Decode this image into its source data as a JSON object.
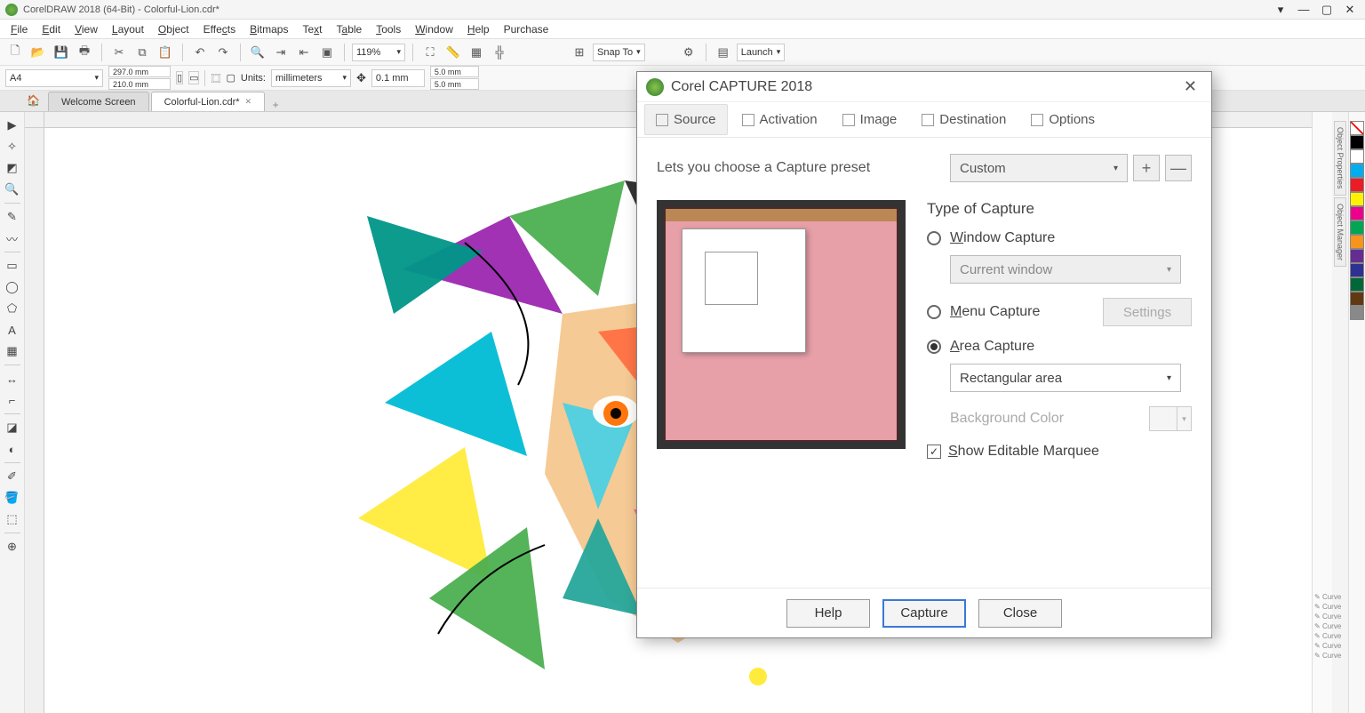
{
  "titlebar": {
    "text": "CorelDRAW 2018 (64-Bit) - Colorful-Lion.cdr*"
  },
  "menus": [
    "File",
    "Edit",
    "View",
    "Layout",
    "Object",
    "Effects",
    "Bitmaps",
    "Text",
    "Table",
    "Tools",
    "Window",
    "Help",
    "Purchase"
  ],
  "toolbar": {
    "zoom": "119%",
    "snap_label": "Snap To",
    "launch_label": "Launch"
  },
  "propbar": {
    "paper": "A4",
    "width": "297.0 mm",
    "height": "210.0 mm",
    "units_label": "Units:",
    "units": "millimeters",
    "nudge": "0.1 mm",
    "dup_x": "5.0 mm",
    "dup_y": "5.0 mm"
  },
  "tabs": {
    "welcome": "Welcome Screen",
    "doc": "Colorful-Lion.cdr*"
  },
  "dockers": {
    "tab1": "Object Properties",
    "tab2": "Object Manager"
  },
  "objlist": {
    "item": "Curve"
  },
  "palette": [
    "#000000",
    "#ffffff",
    "#00aeef",
    "#ed1c24",
    "#fff200",
    "#ec008c",
    "#00a651",
    "#f7941d",
    "#662d91",
    "#898989",
    "#b0e0e6",
    "#90ee90",
    "#d2691e"
  ],
  "dialog": {
    "title": "Corel CAPTURE 2018",
    "tabs": {
      "source": "Source",
      "activation": "Activation",
      "image": "Image",
      "destination": "Destination",
      "options": "Options"
    },
    "preset_label": "Lets you choose a Capture preset",
    "preset_value": "Custom",
    "capture_heading": "Type of Capture",
    "window_capture": "Window Capture",
    "window_sub": "Current window",
    "menu_capture": "Menu Capture",
    "settings_btn": "Settings",
    "area_capture": "Area Capture",
    "area_sub": "Rectangular area",
    "bg_color": "Background Color",
    "show_marquee": "Show Editable Marquee",
    "help": "Help",
    "capture": "Capture",
    "close": "Close"
  }
}
